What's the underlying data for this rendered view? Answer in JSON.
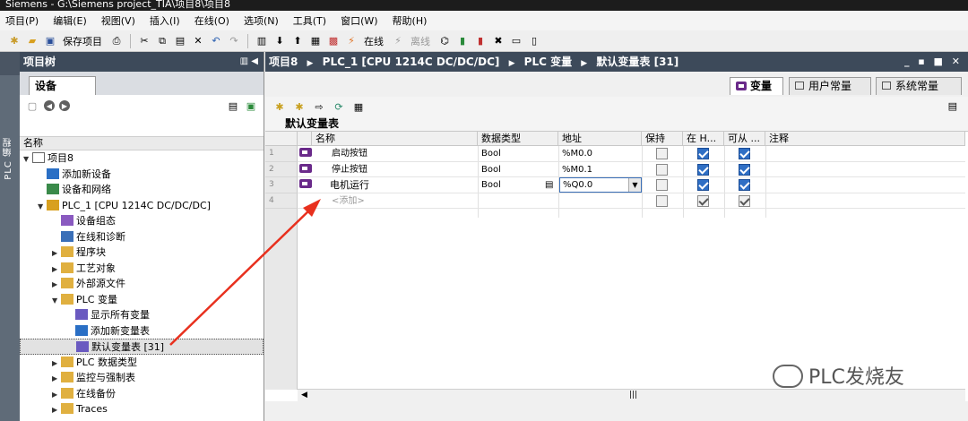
{
  "window": {
    "title": "Siemens  -  G:\\Siemens project_TIA\\项目8\\项目8"
  },
  "menu": [
    "项目(P)",
    "编辑(E)",
    "视图(V)",
    "插入(I)",
    "在线(O)",
    "选项(N)",
    "工具(T)",
    "窗口(W)",
    "帮助(H)"
  ],
  "toolbar": {
    "save_label": "保存项目",
    "online_label": "在线",
    "offline_label": "离线"
  },
  "side_tab": {
    "label": "PLC 编程"
  },
  "project_tree": {
    "title": "项目树",
    "device_tab": "设备",
    "column_name": "名称",
    "items": [
      {
        "label": "项目8",
        "arrow": "▼",
        "indent": 0
      },
      {
        "label": "添加新设备",
        "arrow": "",
        "indent": 1
      },
      {
        "label": "设备和网络",
        "arrow": "",
        "indent": 1
      },
      {
        "label": "PLC_1 [CPU 1214C DC/DC/DC]",
        "arrow": "▼",
        "indent": 1
      },
      {
        "label": "设备组态",
        "arrow": "",
        "indent": 2
      },
      {
        "label": "在线和诊断",
        "arrow": "",
        "indent": 2
      },
      {
        "label": "程序块",
        "arrow": "▶",
        "indent": 2
      },
      {
        "label": "工艺对象",
        "arrow": "▶",
        "indent": 2
      },
      {
        "label": "外部源文件",
        "arrow": "▶",
        "indent": 2
      },
      {
        "label": "PLC 变量",
        "arrow": "▼",
        "indent": 2
      },
      {
        "label": "显示所有变量",
        "arrow": "",
        "indent": 3
      },
      {
        "label": "添加新变量表",
        "arrow": "",
        "indent": 3
      },
      {
        "label": "默认变量表 [31]",
        "arrow": "",
        "indent": 3
      },
      {
        "label": "PLC 数据类型",
        "arrow": "▶",
        "indent": 2
      },
      {
        "label": "监控与强制表",
        "arrow": "▶",
        "indent": 2
      },
      {
        "label": "在线备份",
        "arrow": "▶",
        "indent": 2
      },
      {
        "label": "Traces",
        "arrow": "▶",
        "indent": 2
      }
    ]
  },
  "editor": {
    "breadcrumb": [
      "项目8",
      "PLC_1 [CPU 1214C DC/DC/DC]",
      "PLC 变量",
      "默认变量表 [31]"
    ],
    "window_controls": "_ ▪ ■ ✕",
    "tabs": [
      "变量",
      "用户常量",
      "系统常量"
    ],
    "table_title": "默认变量表",
    "columns": [
      "名称",
      "数据类型",
      "地址",
      "保持",
      "在 H...",
      "可从 ...",
      "注释"
    ],
    "rows": [
      {
        "num": "1",
        "name": "启动按钮",
        "type": "Bool",
        "address": "%M0.0",
        "retain": false,
        "hmi_visible": true,
        "hmi_access": true
      },
      {
        "num": "2",
        "name": "停止按钮",
        "type": "Bool",
        "address": "%M0.1",
        "retain": false,
        "hmi_visible": true,
        "hmi_access": true
      },
      {
        "num": "3",
        "name": "电机运行",
        "type": "Bool",
        "address": "%Q0.0",
        "retain": false,
        "hmi_visible": true,
        "hmi_access": true
      },
      {
        "num": "4",
        "name": "<添加>",
        "type": "",
        "address": "",
        "retain": false,
        "hmi_visible": true,
        "hmi_access": true
      }
    ]
  },
  "watermark": "PLC发烧友",
  "colors": {
    "header_bg": "#3d4a5a",
    "side_tab_bg": "#5f6b78",
    "checkbox_on": "#2f6fc5",
    "arrow": "#e8301e",
    "tag_icon": "#6a2a8a"
  }
}
